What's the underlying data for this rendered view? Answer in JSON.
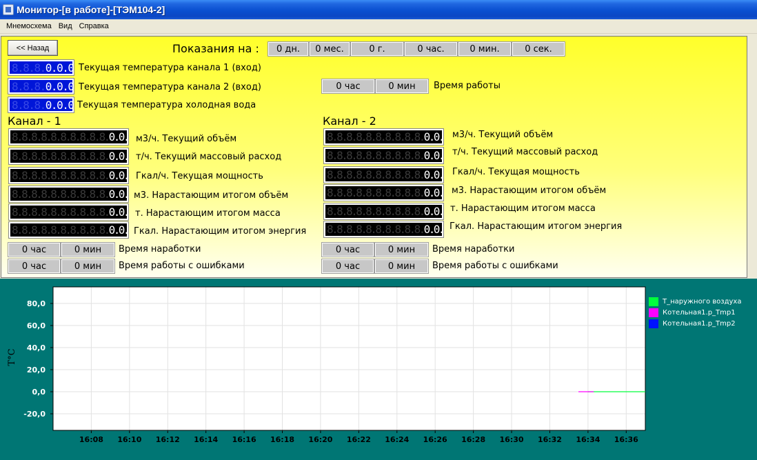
{
  "window": {
    "title": "Монитор-[в работе]-[ТЭМ104-2]"
  },
  "menu": {
    "items": [
      "Мнемосхема",
      "Вид",
      "Справка"
    ]
  },
  "panel": {
    "back_label": "<< Назад",
    "readings_label": "Показания на :",
    "date_fields": [
      "0 дн.",
      "0 мес.",
      "0 г.",
      "0 час.",
      "0 мин.",
      "0 сек."
    ],
    "temps": [
      {
        "dim": "8.8.8.",
        "value": "0.0.0",
        "label": "Текущая температура канала 1 (вход)"
      },
      {
        "dim": "8.8.8.",
        "value": "0.0.0",
        "label": "Текущая температура канала 2 (вход)"
      },
      {
        "dim": "8.8.8.",
        "value": "0.0.0",
        "label": "Текущая температура холодная вода"
      }
    ],
    "work_time": {
      "hours": "0 час",
      "minutes": "0 мин",
      "label": "Время работы"
    },
    "channel1": {
      "title": "Канал - 1",
      "rows": [
        {
          "dim": "8.8.8.8.8.8.8.8.8.8.",
          "value": "0.0.0",
          "label": "м3/ч. Текущий объём"
        },
        {
          "dim": "8.8.8.8.8.8.8.8.8.8.",
          "value": "0.0.0",
          "label": "т/ч. Текущий массовый расход"
        },
        {
          "dim": "8.8.8.8.8.8.8.8.8.8.",
          "value": "0.0.0",
          "label": "Гкал/ч. Текущая мощность"
        },
        {
          "dim": "8.8.8.8.8.8.8.8.8.8.",
          "value": "0.0.0",
          "label": "м3. Нарастающим итогом объём"
        },
        {
          "dim": "8.8.8.8.8.8.8.8.8.8.",
          "value": "0.0.0",
          "label": "т. Нарастающим итогом масса"
        },
        {
          "dim": "8.8.8.8.8.8.8.8.8.8.",
          "value": "0.0.0",
          "label": "Гкал. Нарастающим итогом энергия"
        }
      ],
      "runtime": {
        "hours": "0 час",
        "minutes": "0 мин",
        "label": "Время наработки"
      },
      "errortime": {
        "hours": "0 час",
        "minutes": "0 мин",
        "label": "Время работы с ошибками"
      }
    },
    "channel2": {
      "title": "Канал - 2",
      "rows": [
        {
          "dim": "8.8.8.8.8.8.8.8.8.8.",
          "value": "0.0.0",
          "label": "м3/ч. Текущий объём"
        },
        {
          "dim": "8.8.8.8.8.8.8.8.8.8.",
          "value": "0.0.0",
          "label": "т/ч. Текущий массовый расход"
        },
        {
          "dim": "8.8.8.8.8.8.8.8.8.8.",
          "value": "0.0.0",
          "label": "Гкал/ч. Текущая мощность"
        },
        {
          "dim": "8.8.8.8.8.8.8.8.8.8.",
          "value": "0.0.0",
          "label": "м3. Нарастающим итогом объём"
        },
        {
          "dim": "8.8.8.8.8.8.8.8.8.8.",
          "value": "0.0.0",
          "label": "т. Нарастающим итогом масса"
        },
        {
          "dim": "8.8.8.8.8.8.8.8.8.8.",
          "value": "0.0.0",
          "label": "Гкал. Нарастающим итогом энергия"
        }
      ],
      "runtime": {
        "hours": "0 час",
        "minutes": "0 мин",
        "label": "Время наработки"
      },
      "errortime": {
        "hours": "0 час",
        "minutes": "0 мин",
        "label": "Время работы с ошибками"
      }
    }
  },
  "colors": {
    "background": "#007674",
    "panel_top": "#ffff2a",
    "lcd_blue": "#0016d8"
  },
  "chart_data": {
    "type": "line",
    "ylabel": "T°C",
    "ylim": [
      -35,
      95
    ],
    "yticks": [
      -20,
      0,
      20,
      40,
      60,
      80
    ],
    "ytick_labels": [
      "-20,0",
      "0,0",
      "20,0",
      "40,0",
      "60,0",
      "80,0"
    ],
    "xlim": [
      "16:06",
      "16:37"
    ],
    "xtick_labels": [
      "16:08",
      "16:10",
      "16:12",
      "16:14",
      "16:16",
      "16:18",
      "16:20",
      "16:22",
      "16:24",
      "16:26",
      "16:28",
      "16:30",
      "16:32",
      "16:34",
      "16:36"
    ],
    "grid": true,
    "legend_position": "right",
    "series": [
      {
        "name": "T_наружного воздуха",
        "color": "#00ff3c",
        "x": [
          "16:34",
          "16:37"
        ],
        "y": [
          0,
          0
        ]
      },
      {
        "name": "Котельная1.р_Tmp1",
        "color": "#ff00ff",
        "x": [
          "16:33.5",
          "16:34.3"
        ],
        "y": [
          0,
          0
        ]
      },
      {
        "name": "Котельная1.р_Tmp2",
        "color": "#0010ff",
        "x": [],
        "y": []
      }
    ]
  }
}
